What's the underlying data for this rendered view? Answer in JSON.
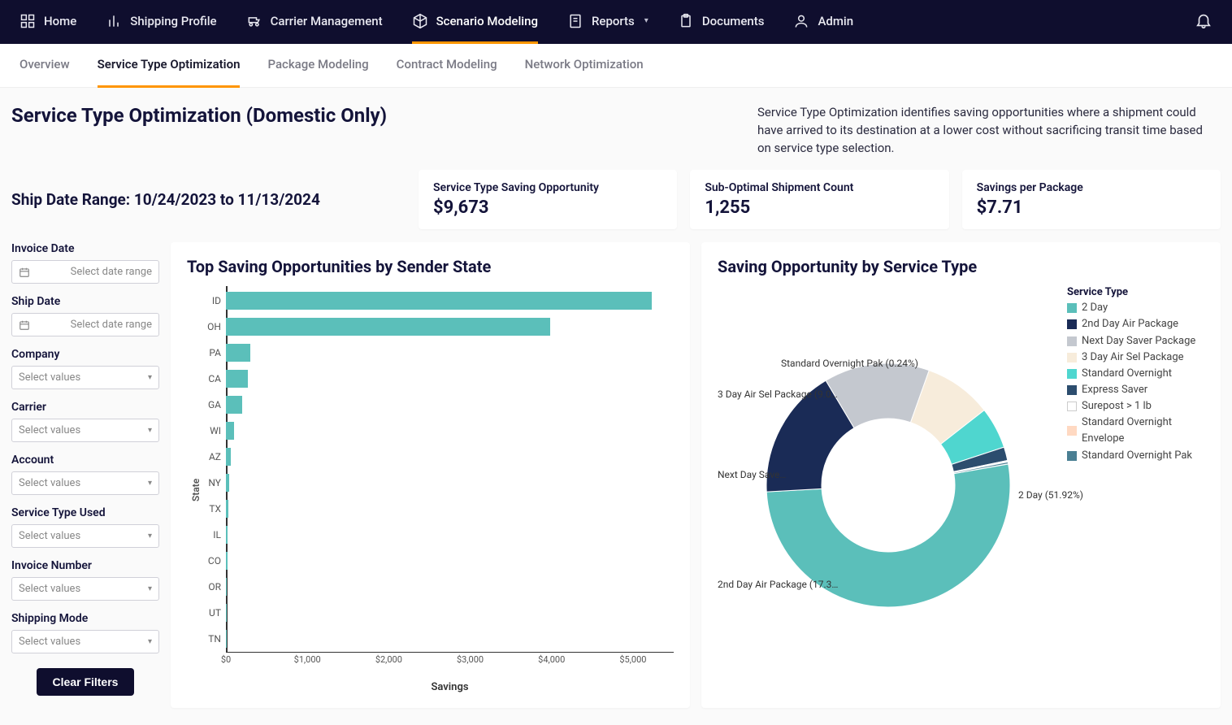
{
  "nav": {
    "items": [
      {
        "label": "Home",
        "icon": "home"
      },
      {
        "label": "Shipping Profile",
        "icon": "chart"
      },
      {
        "label": "Carrier Management",
        "icon": "carrier"
      },
      {
        "label": "Scenario Modeling",
        "icon": "cube",
        "active": true
      },
      {
        "label": "Reports",
        "icon": "report",
        "dropdown": true
      },
      {
        "label": "Documents",
        "icon": "doc"
      },
      {
        "label": "Admin",
        "icon": "user"
      }
    ]
  },
  "subtabs": [
    {
      "label": "Overview"
    },
    {
      "label": "Service Type Optimization",
      "active": true
    },
    {
      "label": "Package Modeling"
    },
    {
      "label": "Contract Modeling"
    },
    {
      "label": "Network Optimization"
    }
  ],
  "page_title": "Service Type Optimization (Domestic Only)",
  "description": "Service Type Optimization identifies saving opportunities where a shipment could have arrived to its destination at a lower cost without sacrificing transit time based on service type selection.",
  "date_range_label": "Ship Date Range: 10/24/2023 to 11/13/2024",
  "kpis": [
    {
      "label": "Service Type Saving Opportunity",
      "value": "$9,673"
    },
    {
      "label": "Sub-Optimal Shipment Count",
      "value": "1,255"
    },
    {
      "label": "Savings per Package",
      "value": "$7.71"
    }
  ],
  "filters": {
    "date_placeholder": "Select date range",
    "select_placeholder": "Select values",
    "groups": [
      {
        "label": "Invoice Date",
        "type": "date"
      },
      {
        "label": "Ship Date",
        "type": "date"
      },
      {
        "label": "Company",
        "type": "select"
      },
      {
        "label": "Carrier",
        "type": "select"
      },
      {
        "label": "Account",
        "type": "select"
      },
      {
        "label": "Service Type Used",
        "type": "select"
      },
      {
        "label": "Invoice Number",
        "type": "select"
      },
      {
        "label": "Shipping Mode",
        "type": "select"
      }
    ],
    "clear_label": "Clear Filters"
  },
  "bar_chart_title": "Top Saving Opportunities by Sender State",
  "donut_chart_title": "Saving Opportunity by Service Type",
  "chart_data": [
    {
      "type": "bar",
      "title": "Top Saving Opportunities by Sender State",
      "xlabel": "Savings",
      "ylabel": "State",
      "xlim": [
        0,
        5500
      ],
      "ticks": [
        "$0",
        "$1,000",
        "$2,000",
        "$3,000",
        "$4,000",
        "$5,000"
      ],
      "categories": [
        "ID",
        "OH",
        "PA",
        "CA",
        "GA",
        "WI",
        "AZ",
        "NY",
        "TX",
        "IL",
        "CO",
        "OR",
        "UT",
        "TN"
      ],
      "values": [
        5250,
        4000,
        300,
        270,
        200,
        100,
        60,
        40,
        30,
        25,
        20,
        15,
        10,
        8
      ]
    },
    {
      "type": "pie",
      "title": "Saving Opportunity by Service Type",
      "legend_title": "Service Type",
      "series": [
        {
          "name": "2 Day",
          "value": 51.92,
          "color": "#5BBFBA",
          "label": "2 Day (51.92%)"
        },
        {
          "name": "2nd Day Air Package",
          "value": 17.3,
          "color": "#1a2b56",
          "label": "2nd Day Air Package (17.3…"
        },
        {
          "name": "Next Day Saver Package",
          "value": 14.0,
          "color": "#c4c8cf",
          "label": "Next Day Save…"
        },
        {
          "name": "3 Day Air Sel Package",
          "value": 9.0,
          "color": "#f7ecdb",
          "label": "3 Day Air Sel Package (9.0…"
        },
        {
          "name": "Standard Overnight",
          "value": 5.5,
          "color": "#4FD6CF",
          "label": ""
        },
        {
          "name": "Express Saver",
          "value": 1.8,
          "color": "#2c4d6e",
          "label": ""
        },
        {
          "name": "Surepost > 1 lb",
          "value": 0.1,
          "color": "#ffffff",
          "label": ""
        },
        {
          "name": "Standard Overnight Envelope",
          "value": 0.1,
          "color": "#ffd9c2",
          "label": ""
        },
        {
          "name": "Standard Overnight Pak",
          "value": 0.24,
          "color": "#4a7f93",
          "label": "Standard Overnight Pak (0.24%)"
        }
      ]
    }
  ]
}
